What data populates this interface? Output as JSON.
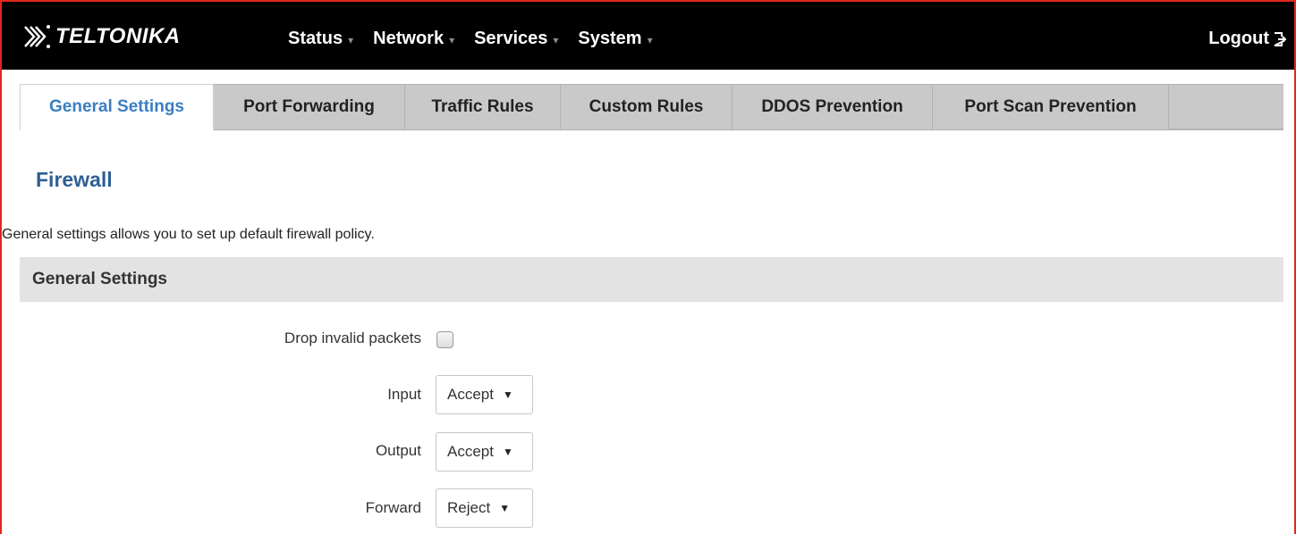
{
  "brand": {
    "name": "TELTONIKA"
  },
  "nav": {
    "items": [
      {
        "label": "Status"
      },
      {
        "label": "Network"
      },
      {
        "label": "Services"
      },
      {
        "label": "System"
      }
    ],
    "logout_label": "Logout"
  },
  "tabs": [
    {
      "label": "General Settings",
      "active": true
    },
    {
      "label": "Port Forwarding"
    },
    {
      "label": "Traffic Rules"
    },
    {
      "label": "Custom Rules"
    },
    {
      "label": "DDOS Prevention"
    },
    {
      "label": "Port Scan Prevention"
    }
  ],
  "page": {
    "title": "Firewall",
    "description": "General settings allows you to set up default firewall policy."
  },
  "section": {
    "title": "General Settings",
    "fields": {
      "drop_invalid": {
        "label": "Drop invalid packets",
        "checked": false
      },
      "input": {
        "label": "Input",
        "value": "Accept"
      },
      "output": {
        "label": "Output",
        "value": "Accept"
      },
      "forward": {
        "label": "Forward",
        "value": "Reject"
      }
    }
  },
  "colors": {
    "accent_border": "#e1261c",
    "topbar_bg": "#000000",
    "active_tab_text": "#3a7ec1",
    "title_blue": "#2f5f95"
  }
}
